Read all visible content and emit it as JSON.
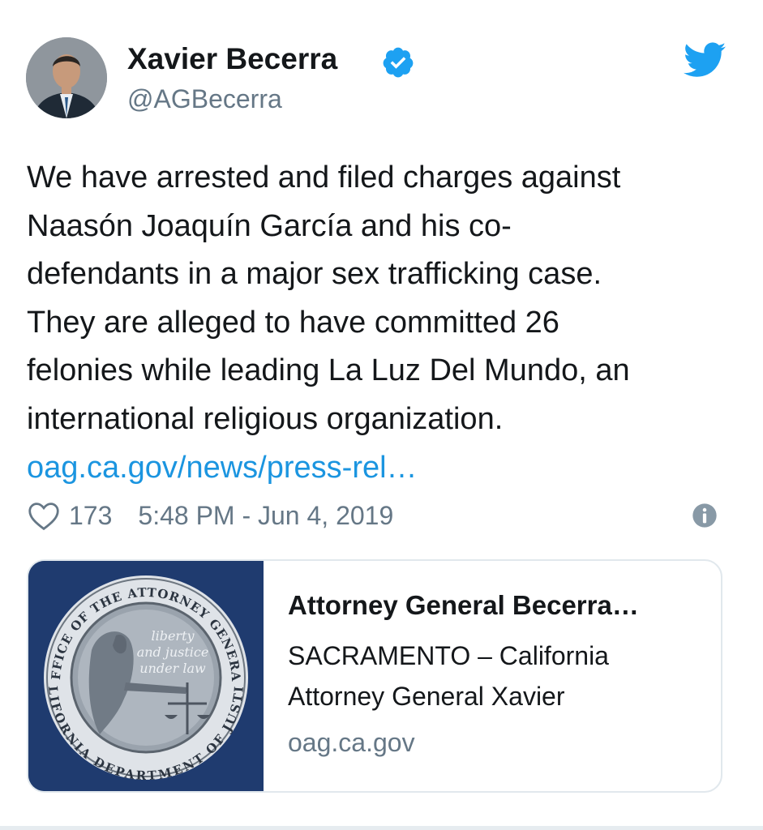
{
  "user": {
    "name": "Xavier Becerra",
    "handle": "@AGBecerra",
    "verified": true
  },
  "tweet": {
    "text_lines": [
      "We have arrested and filed charges against",
      "Naasón Joaquín García and his co-",
      "defendants in a major sex trafficking case.",
      "They are alleged to have committed 26",
      "felonies while leading La Luz Del Mundo, an",
      "international religious organization."
    ],
    "link": "oag.ca.gov/news/press-rel…",
    "likes": "173",
    "timestamp": "5:48 PM - Jun 4, 2019"
  },
  "card": {
    "title": "Attorney General Becerra…",
    "description_lines": [
      "SACRAMENTO – California",
      "Attorney General Xavier"
    ],
    "domain": "oag.ca.gov",
    "seal": {
      "outer_text": "OFFICE OF THE ATTORNEY GENERAL",
      "lower_text": "CALIFORNIA DEPARTMENT OF JUSTICE",
      "motto_lines": [
        "liberty",
        "and justice",
        "under law"
      ]
    }
  },
  "icons": {
    "verified": "verified-badge-icon",
    "twitter": "twitter-bird-icon",
    "like": "heart-icon",
    "info": "info-icon"
  },
  "colors": {
    "brand": "#1da1f2",
    "link": "#1b95e0",
    "secondary_text": "#657786",
    "card_image_bg": "#1f3b6f"
  }
}
